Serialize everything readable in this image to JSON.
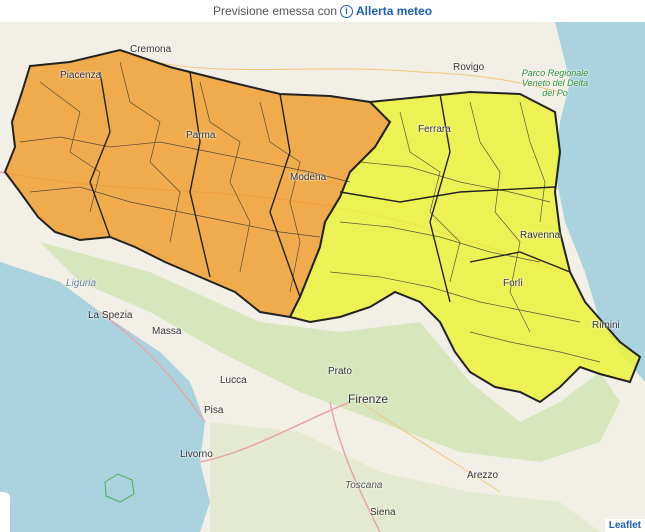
{
  "header": {
    "prefix": "Previsione emessa con",
    "link_label": "Allerta meteo",
    "info_icon": "info-icon"
  },
  "colors": {
    "orange_zone": "#f0a030",
    "yellow_zone": "#ecf23a",
    "sea": "#aad3df",
    "land": "#f2efe6",
    "forest": "#cfe3b3",
    "border": "#222222"
  },
  "places": {
    "cremona": "Cremona",
    "rovigo": "Rovigo",
    "piacenza": "Piacenza",
    "parma": "Parma",
    "ferrara": "Ferrara",
    "modena": "Modena",
    "ravenna": "Ravenna",
    "forli": "Forlì",
    "rimini": "Rimini",
    "liguria": "Liguria",
    "la_spezia": "La Spezia",
    "massa": "Massa",
    "prato": "Prato",
    "lucca": "Lucca",
    "firenze": "Firenze",
    "pisa": "Pisa",
    "livorno": "Livorno",
    "arezzo": "Arezzo",
    "toscana": "Toscana",
    "siena": "Siena",
    "park": "Parco Regionale Veneto del Delta del Po"
  },
  "attribution": "Leaflet"
}
